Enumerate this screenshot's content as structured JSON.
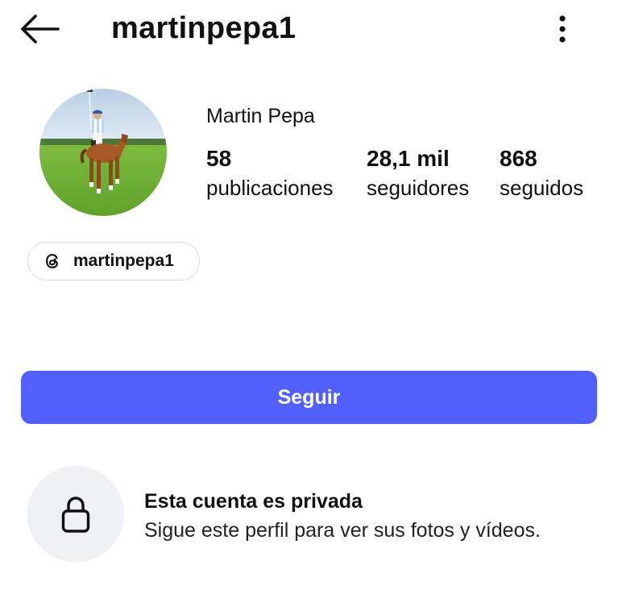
{
  "header": {
    "username": "martinpepa1",
    "back_icon": "arrow-left-icon",
    "more_icon": "more-vertical-icon"
  },
  "profile": {
    "display_name": "Martin Pepa",
    "avatar_icon": "profile-photo-polo-player",
    "stats": {
      "posts": {
        "value": "58",
        "label": "publicaciones"
      },
      "followers": {
        "value": "28,1 mil",
        "label": "seguidores"
      },
      "following": {
        "value": "868",
        "label": "seguidos"
      }
    },
    "threads_link": {
      "icon": "threads-icon",
      "label": "martinpepa1"
    }
  },
  "actions": {
    "follow_label": "Seguir",
    "follow_color": "#5260ff"
  },
  "private_notice": {
    "icon": "lock-icon",
    "title": "Esta cuenta es privada",
    "subtitle": "Sigue este perfil para ver sus fotos y vídeos."
  }
}
